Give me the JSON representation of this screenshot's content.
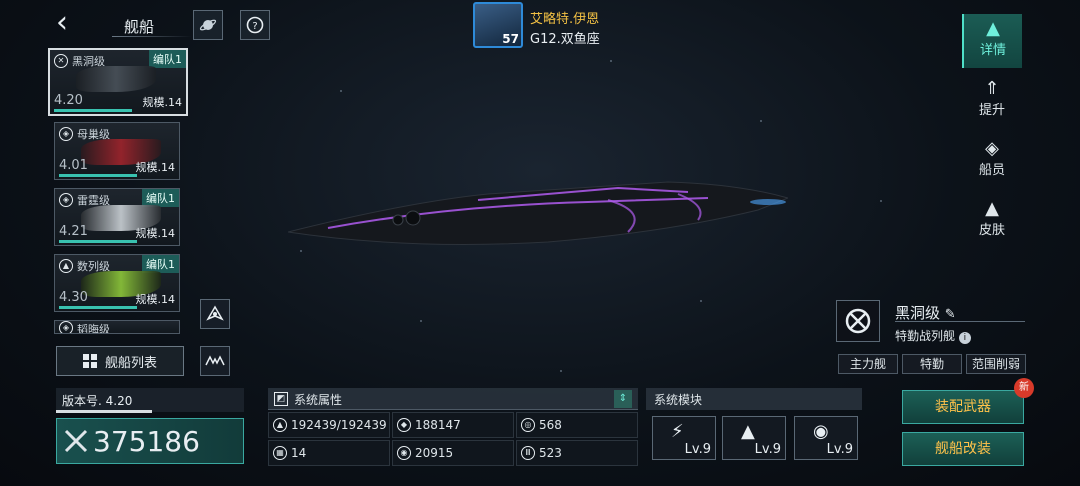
{
  "header": {
    "back_label": "‹",
    "title": "舰船"
  },
  "commander": {
    "name": "艾略特.伊恩",
    "location": "G12.双鱼座",
    "level": "57"
  },
  "ship_list": [
    {
      "class": "黑洞级",
      "team": "编队1",
      "version": "4.20",
      "scale": "规模.14",
      "selected": true
    },
    {
      "class": "母巢级",
      "team": "",
      "version": "4.01",
      "scale": "规模.14",
      "selected": false
    },
    {
      "class": "雷霆级",
      "team": "编队1",
      "version": "4.21",
      "scale": "规模.14",
      "selected": false
    },
    {
      "class": "数列级",
      "team": "编队1",
      "version": "4.30",
      "scale": "规模.14",
      "selected": false
    },
    {
      "class": "韬晦级",
      "team": "",
      "version": "",
      "scale": "",
      "selected": false
    }
  ],
  "ship_list_button": "舰船列表",
  "version": {
    "label": "版本号. 4.20"
  },
  "power": {
    "value": "375186"
  },
  "attributes": {
    "title": "系统属性",
    "cells": [
      {
        "icon": "hull-icon",
        "value": "192439/192439"
      },
      {
        "icon": "armor-icon",
        "value": "188147"
      },
      {
        "icon": "shield-icon",
        "value": "568"
      },
      {
        "icon": "checker-icon",
        "value": "14"
      },
      {
        "icon": "target-icon",
        "value": "20915"
      },
      {
        "icon": "bars-icon",
        "value": "523"
      }
    ]
  },
  "modules": {
    "title": "系统模块",
    "slots": [
      {
        "icon": "weapon-module-icon",
        "level": "Lv.9"
      },
      {
        "icon": "engine-module-icon",
        "level": "Lv.9"
      },
      {
        "icon": "signal-module-icon",
        "level": "Lv.9"
      }
    ]
  },
  "right_tabs": [
    {
      "label": "详情",
      "active": true
    },
    {
      "label": "提升",
      "active": false
    },
    {
      "label": "船员",
      "active": false
    },
    {
      "label": "皮肤",
      "active": false
    }
  ],
  "ship_info": {
    "name": "黑洞级",
    "type": "特勤战列舰",
    "tags": [
      "主力舰",
      "特勤",
      "范围削弱"
    ]
  },
  "actions": {
    "equip_weapons": "装配武器",
    "ship_modify": "舰船改装",
    "new_badge": "新"
  },
  "colors": {
    "accent": "#39c2b0",
    "gold": "#ffc24a",
    "ship_glow": "#b05cf0"
  }
}
